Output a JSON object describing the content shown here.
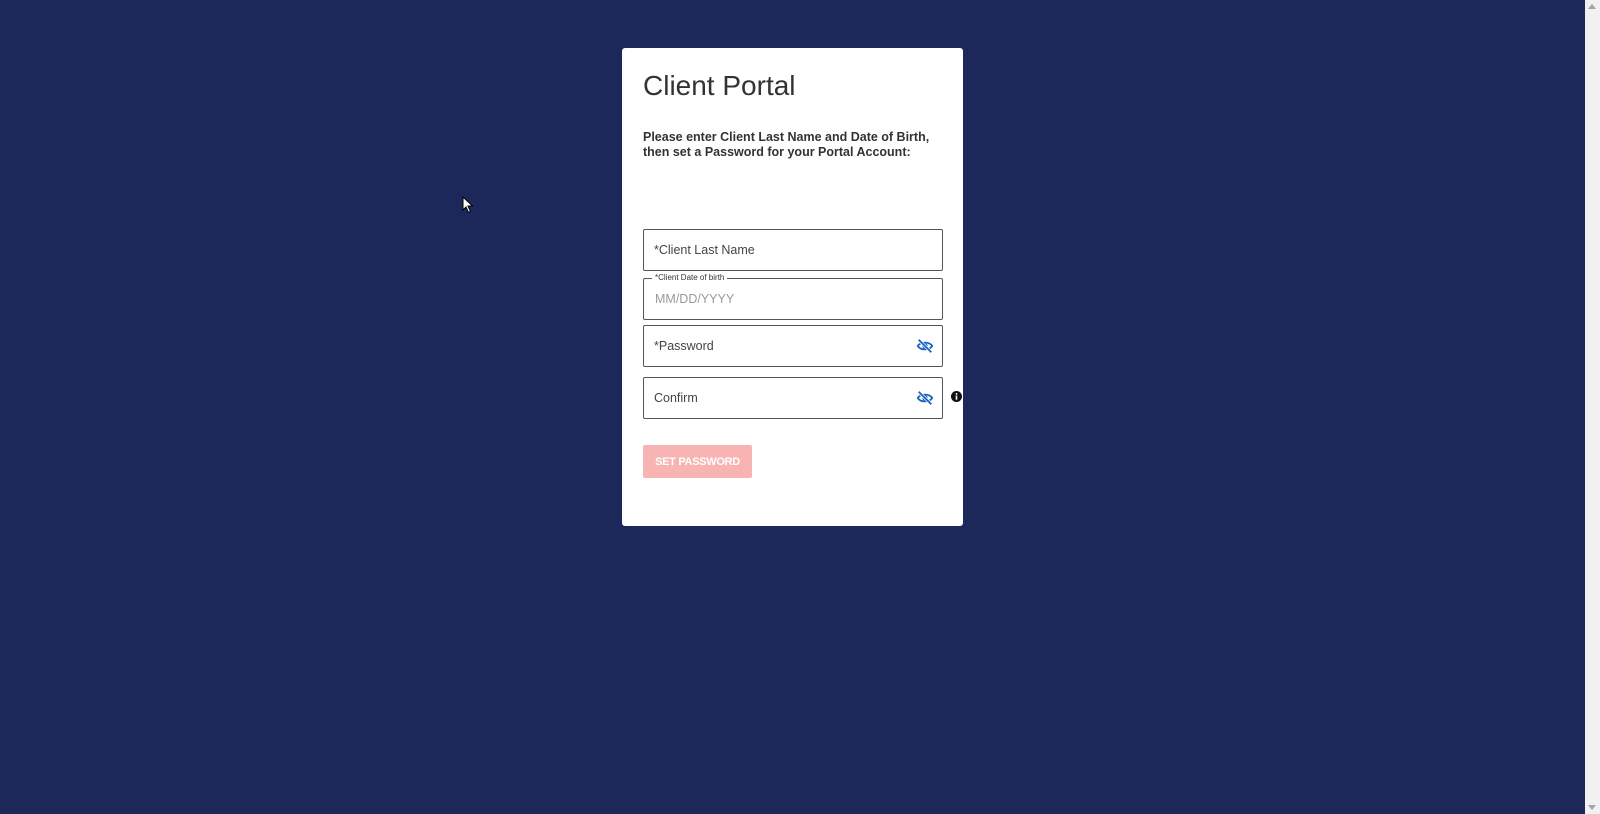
{
  "page": {
    "background_color": "#1b2859",
    "card_color": "#ffffff"
  },
  "portal": {
    "title": "Client Portal",
    "instructions": "Please enter Client Last Name and Date of Birth, then set a Password for your Portal Account:"
  },
  "form": {
    "last_name": {
      "placeholder": "*Client Last Name",
      "value": ""
    },
    "date_of_birth": {
      "label": "*Client Date of birth",
      "placeholder": "MM/DD/YYYY",
      "value": ""
    },
    "password": {
      "placeholder": "*Password",
      "value": "",
      "toggle_icon": "eye-slash-icon"
    },
    "confirm": {
      "placeholder": "Confirm",
      "value": "",
      "toggle_icon": "eye-slash-icon",
      "info_icon": "info-circle-icon"
    },
    "submit": {
      "label": "SET PASSWORD",
      "color": "#f7b4b3",
      "disabled": true
    }
  },
  "colors": {
    "accent_blue": "#1a5fc2",
    "text_dark": "#333333"
  }
}
